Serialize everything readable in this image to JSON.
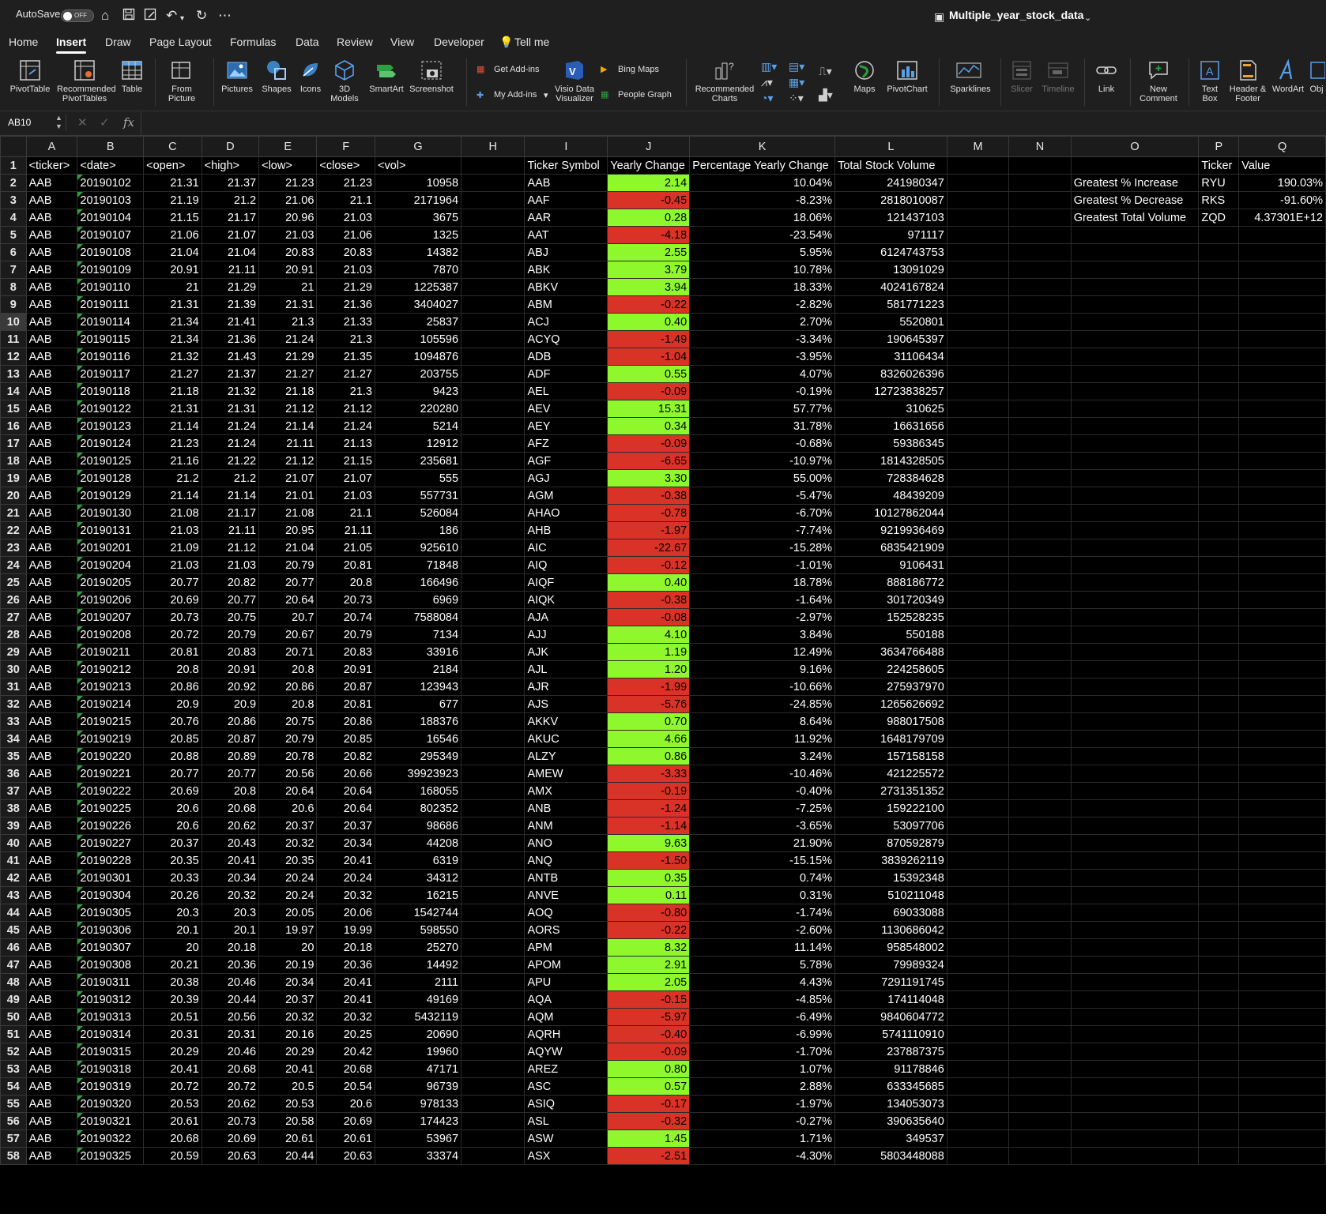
{
  "titlebar": {
    "autosave": "AutoSave",
    "toggle": "OFF",
    "doc_title": "Multiple_year_stock_data"
  },
  "tabs": [
    "Home",
    "Insert",
    "Draw",
    "Page Layout",
    "Formulas",
    "Data",
    "Review",
    "View",
    "Developer",
    "Tell me"
  ],
  "active_tab": "Insert",
  "ribbon": {
    "pivottable": "PivotTable",
    "recommended_pivot": "Recommended PivotTables",
    "table": "Table",
    "from_picture": "From Picture",
    "pictures": "Pictures",
    "shapes": "Shapes",
    "icons": "Icons",
    "models3d": "3D Models",
    "smartart": "SmartArt",
    "screenshot": "Screenshot",
    "get_addins": "Get Add-ins",
    "my_addins": "My Add-ins",
    "visio": "Visio Data Visualizer",
    "bing_maps": "Bing Maps",
    "people_graph": "People Graph",
    "rec_charts": "Recommended Charts",
    "maps": "Maps",
    "pivotchart": "PivotChart",
    "sparklines": "Sparklines",
    "slicer": "Slicer",
    "timeline": "Timeline",
    "link": "Link",
    "new_comment": "New Comment",
    "text_box": "Text Box",
    "header_footer": "Header & Footer",
    "wordart": "WordArt",
    "object": "Obj"
  },
  "formula_bar": {
    "name_box": "AB10",
    "fx": "fx",
    "formula": ""
  },
  "columns": [
    "A",
    "B",
    "C",
    "D",
    "E",
    "F",
    "G",
    "H",
    "I",
    "J",
    "K",
    "L",
    "M",
    "N",
    "O",
    "P",
    "Q"
  ],
  "header_row": {
    "A": "<ticker>",
    "B": "<date>",
    "C": "<open>",
    "D": "<high>",
    "E": "<low>",
    "F": "<close>",
    "G": "<vol>",
    "I": "Ticker Symbol",
    "J": "Yearly Change",
    "K": "Percentage Yearly Change",
    "L": "Total Stock Volume",
    "P": "Ticker",
    "Q": "Value"
  },
  "summary": [
    {
      "label": "Greatest % Increase",
      "ticker": "RYU",
      "value": "190.03%"
    },
    {
      "label": "Greatest % Decrease",
      "ticker": "RKS",
      "value": "-91.60%"
    },
    {
      "label": "Greatest Total Volume",
      "ticker": "ZQD",
      "value": "4.37301E+12"
    }
  ],
  "rows": [
    [
      "AAB",
      "20190102",
      "21.31",
      "21.37",
      "21.23",
      "21.23",
      "10958",
      "AAB",
      "2.14",
      "10.04%",
      "241980347"
    ],
    [
      "AAB",
      "20190103",
      "21.19",
      "21.2",
      "21.06",
      "21.1",
      "2171964",
      "AAF",
      "-0.45",
      "-8.23%",
      "2818010087"
    ],
    [
      "AAB",
      "20190104",
      "21.15",
      "21.17",
      "20.96",
      "21.03",
      "3675",
      "AAR",
      "0.28",
      "18.06%",
      "121437103"
    ],
    [
      "AAB",
      "20190107",
      "21.06",
      "21.07",
      "21.03",
      "21.06",
      "1325",
      "AAT",
      "-4.18",
      "-23.54%",
      "971117"
    ],
    [
      "AAB",
      "20190108",
      "21.04",
      "21.04",
      "20.83",
      "20.83",
      "14382",
      "ABJ",
      "2.55",
      "5.95%",
      "6124743753"
    ],
    [
      "AAB",
      "20190109",
      "20.91",
      "21.11",
      "20.91",
      "21.03",
      "7870",
      "ABK",
      "3.79",
      "10.78%",
      "13091029"
    ],
    [
      "AAB",
      "20190110",
      "21",
      "21.29",
      "21",
      "21.29",
      "1225387",
      "ABKV",
      "3.94",
      "18.33%",
      "4024167824"
    ],
    [
      "AAB",
      "20190111",
      "21.31",
      "21.39",
      "21.31",
      "21.36",
      "3404027",
      "ABM",
      "-0.22",
      "-2.82%",
      "581771223"
    ],
    [
      "AAB",
      "20190114",
      "21.34",
      "21.41",
      "21.3",
      "21.33",
      "25837",
      "ACJ",
      "0.40",
      "2.70%",
      "5520801"
    ],
    [
      "AAB",
      "20190115",
      "21.34",
      "21.36",
      "21.24",
      "21.3",
      "105596",
      "ACYQ",
      "-1.49",
      "-3.34%",
      "190645397"
    ],
    [
      "AAB",
      "20190116",
      "21.32",
      "21.43",
      "21.29",
      "21.35",
      "1094876",
      "ADB",
      "-1.04",
      "-3.95%",
      "31106434"
    ],
    [
      "AAB",
      "20190117",
      "21.27",
      "21.37",
      "21.27",
      "21.27",
      "203755",
      "ADF",
      "0.55",
      "4.07%",
      "8326026396"
    ],
    [
      "AAB",
      "20190118",
      "21.18",
      "21.32",
      "21.18",
      "21.3",
      "9423",
      "AEL",
      "-0.09",
      "-0.19%",
      "12723838257"
    ],
    [
      "AAB",
      "20190122",
      "21.31",
      "21.31",
      "21.12",
      "21.12",
      "220280",
      "AEV",
      "15.31",
      "57.77%",
      "310625"
    ],
    [
      "AAB",
      "20190123",
      "21.14",
      "21.24",
      "21.14",
      "21.24",
      "5214",
      "AEY",
      "0.34",
      "31.78%",
      "16631656"
    ],
    [
      "AAB",
      "20190124",
      "21.23",
      "21.24",
      "21.11",
      "21.13",
      "12912",
      "AFZ",
      "-0.09",
      "-0.68%",
      "59386345"
    ],
    [
      "AAB",
      "20190125",
      "21.16",
      "21.22",
      "21.12",
      "21.15",
      "235681",
      "AGF",
      "-6.65",
      "-10.97%",
      "1814328505"
    ],
    [
      "AAB",
      "20190128",
      "21.2",
      "21.2",
      "21.07",
      "21.07",
      "555",
      "AGJ",
      "3.30",
      "55.00%",
      "728384628"
    ],
    [
      "AAB",
      "20190129",
      "21.14",
      "21.14",
      "21.01",
      "21.03",
      "557731",
      "AGM",
      "-0.38",
      "-5.47%",
      "48439209"
    ],
    [
      "AAB",
      "20190130",
      "21.08",
      "21.17",
      "21.08",
      "21.1",
      "526084",
      "AHAO",
      "-0.78",
      "-6.70%",
      "10127862044"
    ],
    [
      "AAB",
      "20190131",
      "21.03",
      "21.11",
      "20.95",
      "21.11",
      "186",
      "AHB",
      "-1.97",
      "-7.74%",
      "9219936469"
    ],
    [
      "AAB",
      "20190201",
      "21.09",
      "21.12",
      "21.04",
      "21.05",
      "925610",
      "AIC",
      "-22.67",
      "-15.28%",
      "6835421909"
    ],
    [
      "AAB",
      "20190204",
      "21.03",
      "21.03",
      "20.79",
      "20.81",
      "71848",
      "AIQ",
      "-0.12",
      "-1.01%",
      "9106431"
    ],
    [
      "AAB",
      "20190205",
      "20.77",
      "20.82",
      "20.77",
      "20.8",
      "166496",
      "AIQF",
      "0.40",
      "18.78%",
      "888186772"
    ],
    [
      "AAB",
      "20190206",
      "20.69",
      "20.77",
      "20.64",
      "20.73",
      "6969",
      "AIQK",
      "-0.38",
      "-1.64%",
      "301720349"
    ],
    [
      "AAB",
      "20190207",
      "20.73",
      "20.75",
      "20.7",
      "20.74",
      "7588084",
      "AJA",
      "-0.08",
      "-2.97%",
      "152528235"
    ],
    [
      "AAB",
      "20190208",
      "20.72",
      "20.79",
      "20.67",
      "20.79",
      "7134",
      "AJJ",
      "4.10",
      "3.84%",
      "550188"
    ],
    [
      "AAB",
      "20190211",
      "20.81",
      "20.83",
      "20.71",
      "20.83",
      "33916",
      "AJK",
      "1.19",
      "12.49%",
      "3634766488"
    ],
    [
      "AAB",
      "20190212",
      "20.8",
      "20.91",
      "20.8",
      "20.91",
      "2184",
      "AJL",
      "1.20",
      "9.16%",
      "224258605"
    ],
    [
      "AAB",
      "20190213",
      "20.86",
      "20.92",
      "20.86",
      "20.87",
      "123943",
      "AJR",
      "-1.99",
      "-10.66%",
      "275937970"
    ],
    [
      "AAB",
      "20190214",
      "20.9",
      "20.9",
      "20.8",
      "20.81",
      "677",
      "AJS",
      "-5.76",
      "-24.85%",
      "1265626692"
    ],
    [
      "AAB",
      "20190215",
      "20.76",
      "20.86",
      "20.75",
      "20.86",
      "188376",
      "AKKV",
      "0.70",
      "8.64%",
      "988017508"
    ],
    [
      "AAB",
      "20190219",
      "20.85",
      "20.87",
      "20.79",
      "20.85",
      "16546",
      "AKUC",
      "4.66",
      "11.92%",
      "1648179709"
    ],
    [
      "AAB",
      "20190220",
      "20.88",
      "20.89",
      "20.78",
      "20.82",
      "295349",
      "ALZY",
      "0.86",
      "3.24%",
      "157158158"
    ],
    [
      "AAB",
      "20190221",
      "20.77",
      "20.77",
      "20.56",
      "20.66",
      "39923923",
      "AMEW",
      "-3.33",
      "-10.46%",
      "421225572"
    ],
    [
      "AAB",
      "20190222",
      "20.69",
      "20.8",
      "20.64",
      "20.64",
      "168055",
      "AMX",
      "-0.19",
      "-0.40%",
      "2731351352"
    ],
    [
      "AAB",
      "20190225",
      "20.6",
      "20.68",
      "20.6",
      "20.64",
      "802352",
      "ANB",
      "-1.24",
      "-7.25%",
      "159222100"
    ],
    [
      "AAB",
      "20190226",
      "20.6",
      "20.62",
      "20.37",
      "20.37",
      "98686",
      "ANM",
      "-1.14",
      "-3.65%",
      "53097706"
    ],
    [
      "AAB",
      "20190227",
      "20.37",
      "20.43",
      "20.32",
      "20.34",
      "44208",
      "ANO",
      "9.63",
      "21.90%",
      "870592879"
    ],
    [
      "AAB",
      "20190228",
      "20.35",
      "20.41",
      "20.35",
      "20.41",
      "6319",
      "ANQ",
      "-1.50",
      "-15.15%",
      "3839262119"
    ],
    [
      "AAB",
      "20190301",
      "20.33",
      "20.34",
      "20.24",
      "20.24",
      "34312",
      "ANTB",
      "0.35",
      "0.74%",
      "15392348"
    ],
    [
      "AAB",
      "20190304",
      "20.26",
      "20.32",
      "20.24",
      "20.32",
      "16215",
      "ANVE",
      "0.11",
      "0.31%",
      "510211048"
    ],
    [
      "AAB",
      "20190305",
      "20.3",
      "20.3",
      "20.05",
      "20.06",
      "1542744",
      "AOQ",
      "-0.80",
      "-1.74%",
      "69033088"
    ],
    [
      "AAB",
      "20190306",
      "20.1",
      "20.1",
      "19.97",
      "19.99",
      "598550",
      "AORS",
      "-0.22",
      "-2.60%",
      "1130686042"
    ],
    [
      "AAB",
      "20190307",
      "20",
      "20.18",
      "20",
      "20.18",
      "25270",
      "APM",
      "8.32",
      "11.14%",
      "958548002"
    ],
    [
      "AAB",
      "20190308",
      "20.21",
      "20.36",
      "20.19",
      "20.36",
      "14492",
      "APOM",
      "2.91",
      "5.78%",
      "79989324"
    ],
    [
      "AAB",
      "20190311",
      "20.38",
      "20.46",
      "20.34",
      "20.41",
      "2111",
      "APU",
      "2.05",
      "4.43%",
      "7291191745"
    ],
    [
      "AAB",
      "20190312",
      "20.39",
      "20.44",
      "20.37",
      "20.41",
      "49169",
      "AQA",
      "-0.15",
      "-4.85%",
      "174114048"
    ],
    [
      "AAB",
      "20190313",
      "20.51",
      "20.56",
      "20.32",
      "20.32",
      "5432119",
      "AQM",
      "-5.97",
      "-6.49%",
      "9840604772"
    ],
    [
      "AAB",
      "20190314",
      "20.31",
      "20.31",
      "20.16",
      "20.25",
      "20690",
      "AQRH",
      "-0.40",
      "-6.99%",
      "5741110910"
    ],
    [
      "AAB",
      "20190315",
      "20.29",
      "20.46",
      "20.29",
      "20.42",
      "19960",
      "AQYW",
      "-0.09",
      "-1.70%",
      "237887375"
    ],
    [
      "AAB",
      "20190318",
      "20.41",
      "20.68",
      "20.41",
      "20.68",
      "47171",
      "AREZ",
      "0.80",
      "1.07%",
      "91178846"
    ],
    [
      "AAB",
      "20190319",
      "20.72",
      "20.72",
      "20.5",
      "20.54",
      "96739",
      "ASC",
      "0.57",
      "2.88%",
      "633345685"
    ],
    [
      "AAB",
      "20190320",
      "20.53",
      "20.62",
      "20.53",
      "20.6",
      "978133",
      "ASIQ",
      "-0.17",
      "-1.97%",
      "134053073"
    ],
    [
      "AAB",
      "20190321",
      "20.61",
      "20.73",
      "20.58",
      "20.69",
      "174423",
      "ASL",
      "-0.32",
      "-0.27%",
      "390635640"
    ],
    [
      "AAB",
      "20190322",
      "20.68",
      "20.69",
      "20.61",
      "20.61",
      "53967",
      "ASW",
      "1.45",
      "1.71%",
      "349537"
    ],
    [
      "AAB",
      "20190325",
      "20.59",
      "20.63",
      "20.44",
      "20.63",
      "33374",
      "ASX",
      "-2.51",
      "-4.30%",
      "5803448088"
    ]
  ],
  "colors": {
    "positive": "#8ef82d",
    "negative": "#d93226",
    "background": "#000000",
    "chrome": "#1f1f1f"
  }
}
